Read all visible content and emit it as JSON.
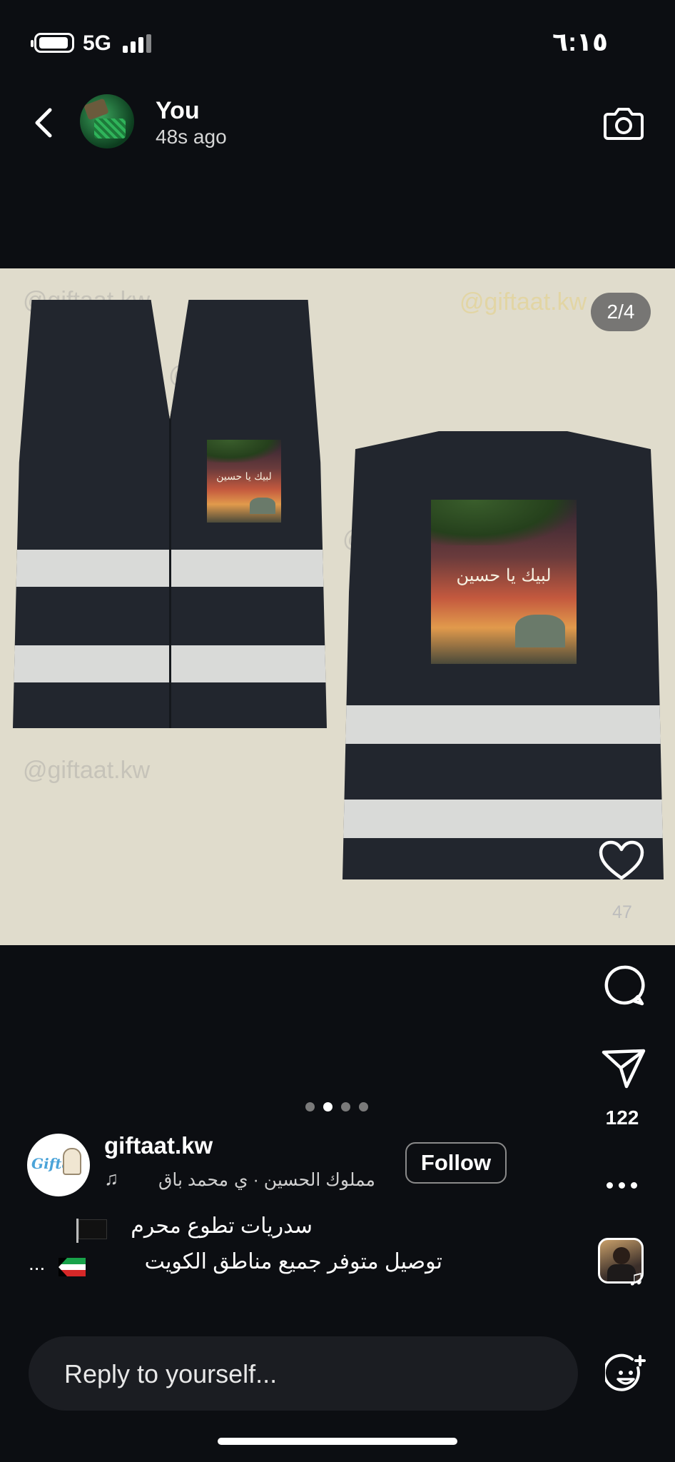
{
  "status_bar": {
    "network": "5G",
    "time": "٦:١٥"
  },
  "story_header": {
    "user": "You",
    "time_ago": "48s ago"
  },
  "media": {
    "counter": "2/4",
    "watermark": "@giftaat.kw",
    "print_text": "لبيك يا حسين",
    "page_dots": 4,
    "active_dot": 2
  },
  "actions": {
    "likes": "47",
    "shares": "122"
  },
  "post": {
    "username": "giftaat.kw",
    "audio_artist": "محمد باق",
    "audio_title": "مملوك الحسين · ي",
    "follow_label": "Follow",
    "caption_line1": "سدريات تطوع محرم",
    "caption_line2": "توصيل متوفر جميع مناطق الكويت",
    "caption_more": "..."
  },
  "reply": {
    "placeholder": "Reply to yourself..."
  },
  "colors": {
    "background": "#0c0e12",
    "media_bg": "#e0dccc",
    "vest": "#22262e",
    "reflective": "#d9dad8"
  }
}
